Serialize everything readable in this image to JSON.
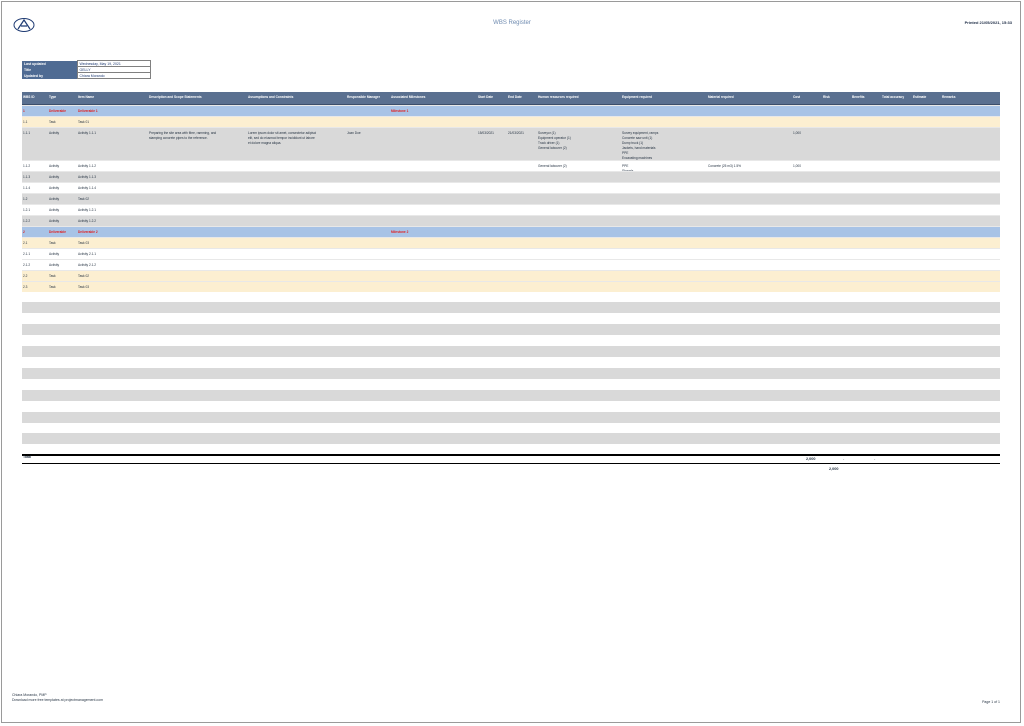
{
  "header": {
    "title": "WBS Register",
    "printed": "Printed 21/05/2021, 15:33"
  },
  "info": [
    {
      "label": "Last updated",
      "value": "Wednesday, May 19, 2021"
    },
    {
      "label": "Title",
      "value": "GELLY"
    },
    {
      "label": "Updated by",
      "value": "Chiara Morando"
    }
  ],
  "columns": [
    "WBS ID",
    "Type",
    "Item Name",
    "Description and Scope Statements",
    "Assumptions and Constraints",
    "Responsible Manager",
    "Associated Milestones",
    "Start Date",
    "End Date",
    "Human resources required",
    "Equipment required",
    "Material required",
    "Cost",
    "Risk",
    "Benefits",
    "Total accuracy",
    "Estimate",
    "Remarks"
  ],
  "rows": [
    {
      "kind": "deliv",
      "id": "1",
      "type": "Deliverable",
      "name": "Deliverable 1",
      "milestone": "Milestone 1"
    },
    {
      "kind": "task",
      "id": "1.1",
      "type": "Task",
      "name": "Task 01"
    },
    {
      "kind": "acc",
      "id": "1.1.1",
      "type": "Activity",
      "name": "Activity 1.1.1",
      "desc": "Preparing the site area with fibre, ramming, and\nstamping concrete pipes to the reference.",
      "assump": "Lorem ipsum dolor sit amet, consectetur adipisci\nelit, sed do eiusmod tempor incididunt ut labore\net dolore magna aliqua.",
      "resp": "Joan Doe",
      "start": "15/03/2021",
      "end": "21/03/2021",
      "hr": "Surveyor (1)\nEquipment operator (1)\nTruck driver (1)\nGeneral labourer (2)",
      "equip": "Survey equipment, ramps\nConcrete saw unit (1)\nDump truck (1)\nJackets, hand materials\nPPE\nExcavating machines",
      "cost": "1,000"
    },
    {
      "kind": "plain",
      "id": "1.1.2",
      "type": "Activity",
      "name": "Activity 1.1.2",
      "hr": "General labourer (2)",
      "equip": "PPE\nShovels",
      "material": "Concrete (25 m3) 1.5%",
      "cost": "1,000"
    },
    {
      "kind": "acc",
      "id": "1.1.3",
      "type": "Activity",
      "name": "Activity 1.1.3"
    },
    {
      "kind": "plain",
      "id": "1.1.4",
      "type": "Activity",
      "name": "Activity 1.1.4"
    },
    {
      "kind": "acc",
      "id": "1.2",
      "type": "Activity",
      "name": "Task 02"
    },
    {
      "kind": "plain",
      "id": "1.2.1",
      "type": "Activity",
      "name": "Activity 1.2.1"
    },
    {
      "kind": "acc",
      "id": "1.2.2",
      "type": "Activity",
      "name": "Activity 1.2.2"
    },
    {
      "kind": "deliv",
      "id": "2",
      "type": "Deliverable",
      "name": "Deliverable 2",
      "milestone": "Milestone 2"
    },
    {
      "kind": "task",
      "id": "2.1",
      "type": "Task",
      "name": "Task 03"
    },
    {
      "kind": "plain",
      "id": "2.1.1",
      "type": "Activity",
      "name": "Activity 2.1.1"
    },
    {
      "kind": "plain",
      "id": "2.1.2",
      "type": "Activity",
      "name": "Activity 2.1.2"
    },
    {
      "kind": "task",
      "id": "2.2",
      "type": "Task",
      "name": "Task 02"
    },
    {
      "kind": "task",
      "id": "2.3",
      "type": "Task",
      "name": "Task 03"
    }
  ],
  "totals": {
    "label": "Total",
    "cost": "2,000",
    "risk": "-",
    "benefits": "-",
    "grand": "2,000"
  },
  "footer": {
    "line1": "Chiara Morando, PMP",
    "line2": "Download more free templates at projectmanagement.com",
    "page": "Page 1 of 1"
  }
}
